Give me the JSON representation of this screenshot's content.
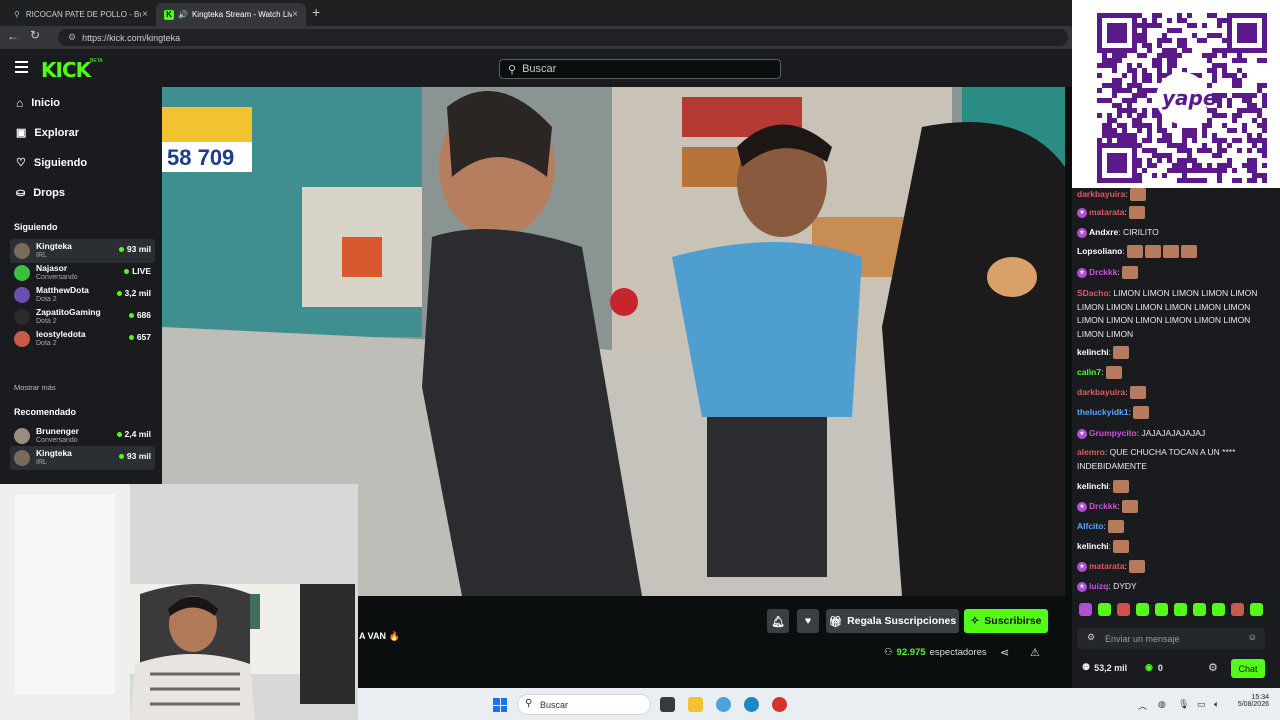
{
  "browser": {
    "tabs": [
      {
        "title": "RICOCAN PATE DE POLLO - Búsqu",
        "active": false
      },
      {
        "title": "Kingteka Stream - Watch Live",
        "active": true
      }
    ],
    "url": "https://kick.com/kingteka"
  },
  "header": {
    "logo": "KICK",
    "beta": "BETA",
    "search_placeholder": "Buscar"
  },
  "nav": [
    {
      "label": "Inicio",
      "icon": "home-icon"
    },
    {
      "label": "Explorar",
      "icon": "compass-icon"
    },
    {
      "label": "Siguiendo",
      "icon": "heart-icon"
    },
    {
      "label": "Drops",
      "icon": "drops-icon"
    }
  ],
  "following": {
    "title": "Siguiendo",
    "channels": [
      {
        "name": "Kingteka",
        "category": "IRL",
        "viewers": "93 mil",
        "color": "#7a6a5a",
        "selected": true
      },
      {
        "name": "Najasor",
        "category": "Conversando",
        "viewers": "LIVE",
        "color": "#3bbf43",
        "selected": false
      },
      {
        "name": "MatthewDota",
        "category": "Dota 2",
        "viewers": "3,2 mil",
        "color": "#6b4fb0",
        "selected": false
      },
      {
        "name": "ZapatitoGaming",
        "category": "Dota 2",
        "viewers": "686",
        "color": "#2a2a2a",
        "selected": false
      },
      {
        "name": "leostyledota",
        "category": "Dota 2",
        "viewers": "657",
        "color": "#c75b4a",
        "selected": false
      }
    ],
    "more": "Mostrar más"
  },
  "recommended": {
    "title": "Recomendado",
    "channels": [
      {
        "name": "Brunenger",
        "category": "Conversando",
        "viewers": "2,4 mil",
        "color": "#9a8c7e",
        "selected": false
      },
      {
        "name": "Kingteka",
        "category": "IRL",
        "viewers": "93 mil",
        "color": "#7a6a5a",
        "selected": true
      }
    ]
  },
  "stream": {
    "title_partial": "A VAN 🔥",
    "gift_label": "Regala Suscripciones",
    "subscribe_label": "Suscribirse",
    "viewers_count": "92.975",
    "viewers_label": "espectadores"
  },
  "chat": {
    "messages": [
      {
        "user": "darkbayuira",
        "color": "#e05a5a",
        "text": "",
        "emotes": 1,
        "badge": false
      },
      {
        "user": "matarata",
        "color": "#e05a5a",
        "text": "",
        "emotes": 1,
        "badge": true
      },
      {
        "user": "Andxre",
        "color": "#ffffff",
        "text": "CIRILITO",
        "emotes": 0,
        "badge": true
      },
      {
        "user": "Lopsoliano",
        "color": "#ffffff",
        "text": "",
        "emotes": 4,
        "badge": false
      },
      {
        "user": "Drckkk",
        "color": "#d14fd6",
        "text": "",
        "emotes": 1,
        "badge": true
      },
      {
        "user": "SDacho",
        "color": "#e05a5a",
        "text": "LIMON LIMON LIMON LIMON LIMON LIMON LIMON LIMON LIMON LIMON LIMON LIMON LIMON LIMON LIMON LIMON LIMON LIMON LIMON",
        "emotes": 0,
        "badge": false
      },
      {
        "user": "kelinchi",
        "color": "#ffffff",
        "text": "",
        "emotes": 1,
        "badge": false
      },
      {
        "user": "calin7",
        "color": "#53fc18",
        "text": "",
        "emotes": 1,
        "badge": false
      },
      {
        "user": "darkbayuira",
        "color": "#e05a5a",
        "text": "",
        "emotes": 1,
        "badge": false
      },
      {
        "user": "theluckyidk1",
        "color": "#5aa7ff",
        "text": "",
        "emotes": 1,
        "badge": false
      },
      {
        "user": "Grumpycito",
        "color": "#d14fd6",
        "text": "JAJAJAJAJAJAJ",
        "emotes": 0,
        "badge": true
      },
      {
        "user": "alemro",
        "color": "#e05a5a",
        "text": "QUE CHUCHA TOCAN A UN **** INDEBIDAMENTE",
        "emotes": 0,
        "badge": false
      },
      {
        "user": "kelinchi",
        "color": "#ffffff",
        "text": "",
        "emotes": 1,
        "badge": false
      },
      {
        "user": "Drckkk",
        "color": "#d14fd6",
        "text": "",
        "emotes": 1,
        "badge": true
      },
      {
        "user": "Alfcito",
        "color": "#5aa7ff",
        "text": "",
        "emotes": 1,
        "badge": false
      },
      {
        "user": "kelinchi",
        "color": "#ffffff",
        "text": "",
        "emotes": 1,
        "badge": false
      },
      {
        "user": "matarata",
        "color": "#e05a5a",
        "text": "",
        "emotes": 1,
        "badge": true
      },
      {
        "user": "luizq",
        "color": "#d14fd6",
        "text": "DYDY",
        "emotes": 0,
        "badge": true
      }
    ],
    "input_placeholder": "Enviar un mensaje",
    "points": "53,2 mil",
    "kicks": "0",
    "chat_button": "Chat"
  },
  "qr": {
    "brand": "yape"
  },
  "taskbar": {
    "search": "Buscar",
    "time": "15:34",
    "date": "5/08/2026"
  },
  "colors": {
    "accent": "#53fc18",
    "bg": "#0b0e0f",
    "panel": "#191b1f"
  }
}
